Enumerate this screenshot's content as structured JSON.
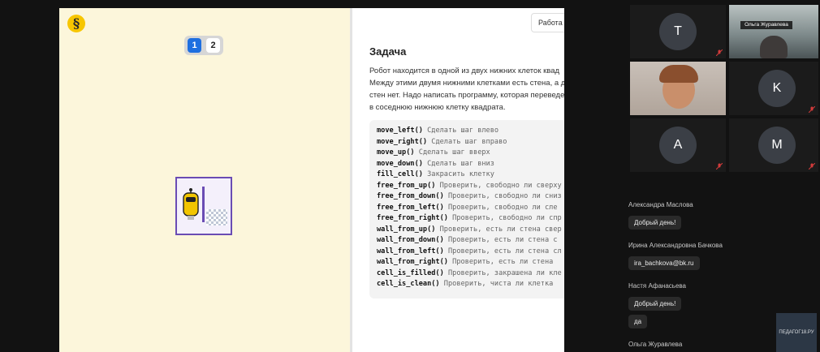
{
  "screen": {
    "logo": "§",
    "pages": [
      "1",
      "2"
    ],
    "top_button": "Работа у",
    "task_title": "Задача",
    "task_lines": [
      "Робот находится в одной из двух нижних клеток квад",
      "Между этими двумя нижними клетками есть стена, а д",
      "стен нет. Надо написать программу, которая переведе",
      "в соседнюю нижнюю клетку квадрата."
    ],
    "code": [
      {
        "fn": "move_left()",
        "comment": "Сделать шаг влево"
      },
      {
        "fn": "move_right()",
        "comment": "Сделать шаг вправо"
      },
      {
        "fn": "move_up()",
        "comment": "Сделать шаг вверх"
      },
      {
        "fn": "move_down()",
        "comment": "Сделать шаг вниз"
      },
      {
        "fn": "fill_cell()",
        "comment": "Закрасить клетку"
      },
      {
        "fn": "free_from_up()",
        "comment": "Проверить, свободно ли сверху"
      },
      {
        "fn": "free_from_down()",
        "comment": "Проверить, свободно ли сниз"
      },
      {
        "fn": "free_from_left()",
        "comment": "Проверить, свободно ли сле"
      },
      {
        "fn": "free_from_right()",
        "comment": "Проверить, свободно ли спр"
      },
      {
        "fn": "wall_from_up()",
        "comment": "Проверить, есть ли стена свер"
      },
      {
        "fn": "wall_from_down()",
        "comment": "Проверить, есть ли стена с"
      },
      {
        "fn": "wall_from_left()",
        "comment": "Проверить, есть ли стена сл"
      },
      {
        "fn": "wall_from_right()",
        "comment": "Проверить, есть ли стена"
      },
      {
        "fn": "cell_is_filled()",
        "comment": "Проверить, закрашена ли кле"
      },
      {
        "fn": "cell_is_clean()",
        "comment": "Проверить, чиста ли клетка"
      }
    ]
  },
  "participants": {
    "t_initial": "T",
    "olga_name": "Ольга Журавлева",
    "k_initial": "K",
    "a_initial": "A",
    "m_initial": "M"
  },
  "chat": [
    {
      "author": "Александра Маслова",
      "messages": [
        "Добрый день!"
      ]
    },
    {
      "author": "Ирина Александровна Бачкова",
      "messages": [
        "ira_bachkova@bk.ru"
      ]
    },
    {
      "author": "Настя Афанасьева",
      "messages": [
        "Добрый день!",
        "да"
      ]
    },
    {
      "author": "Ольга Журавлева",
      "messages": []
    }
  ],
  "watermark": "ПЕДАГОГ18.РУ"
}
